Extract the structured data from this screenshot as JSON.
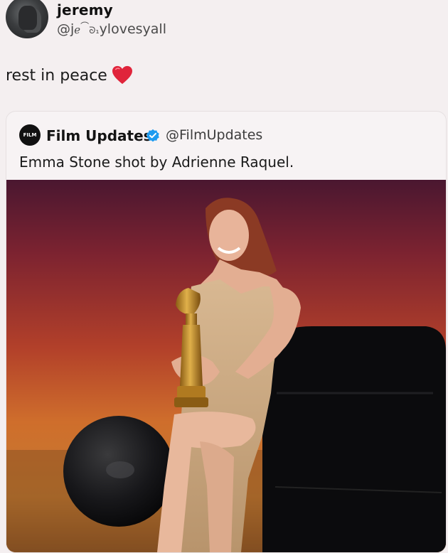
{
  "tweet": {
    "display_name": "jeremy",
    "handle": "@jℓᵉ’₂₁ylovesyall",
    "text": "rest in peace",
    "avatar_icon": "profile-avatar",
    "emoji_icon": "red-heart-icon"
  },
  "quote": {
    "account_name": "Film Updates",
    "account_handle": "@FilmUpdates",
    "avatar_label": "FILM",
    "verified_icon": "verified-badge-icon",
    "text": "Emma Stone shot by Adrienne Raquel.",
    "photo": "photo-emma-stone-golden-globe"
  },
  "colors": {
    "verified_blue": "#1d9bf0",
    "heart_red": "#e0243b",
    "background": "#f4eff0"
  }
}
